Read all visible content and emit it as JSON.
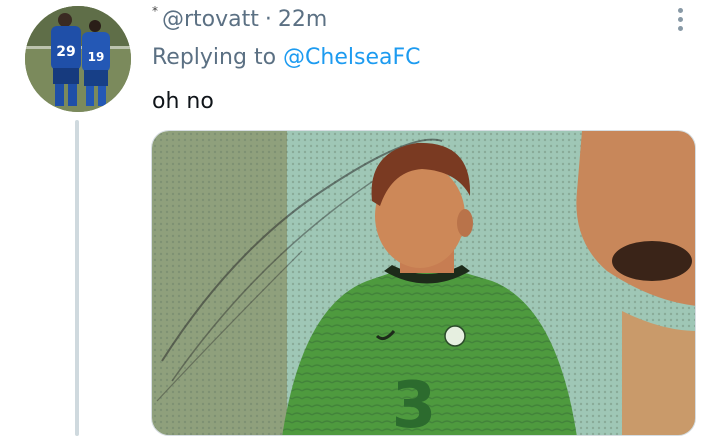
{
  "tweet": {
    "name_mark": "*",
    "handle": "@rtovatt",
    "separator": "·",
    "time": "22m",
    "replying_prefix": "Replying to",
    "replying_handle": "@ChelseaFC",
    "text": "oh no"
  },
  "avatar": {
    "shirt_numbers": [
      "29",
      "19"
    ]
  },
  "media": {
    "shirt_sponsor": "3"
  },
  "icons": {
    "more": "more-vertical-icon",
    "avatar": "profile-avatar"
  },
  "colors": {
    "link": "#1d9bf0",
    "secondary_text": "#5b7083",
    "thread_line": "#cfd9de"
  }
}
